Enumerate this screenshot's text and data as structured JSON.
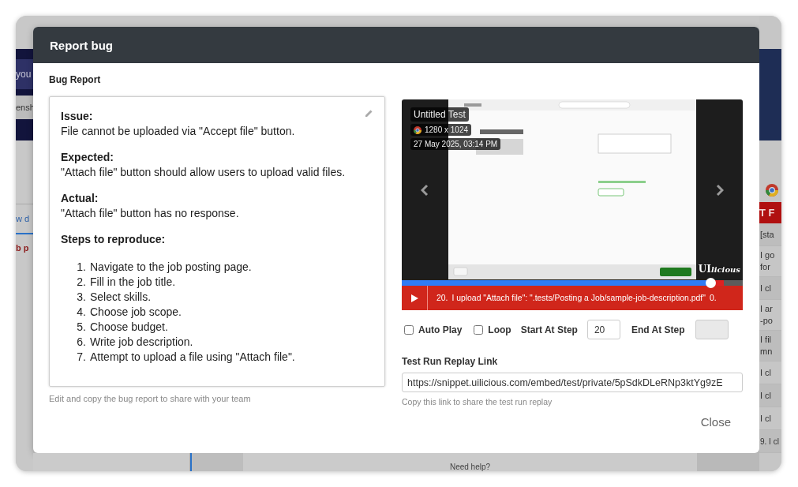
{
  "background_app": {
    "left_texts": [
      {
        "text": "you",
        "kind": "banner"
      },
      {
        "text": "ensh",
        "kind": "strip"
      },
      {
        "text": "w d",
        "kind": "tab"
      },
      {
        "text": "b p",
        "kind": "warning"
      }
    ],
    "right_header": "T F",
    "right_rows": [
      {
        "lines": [
          "[sta"
        ]
      },
      {
        "lines": [
          "I go",
          "for"
        ]
      },
      {
        "lines": [
          "I cl"
        ]
      },
      {
        "lines": [
          "I ar",
          "-po"
        ]
      },
      {
        "lines": [
          "I fil",
          "mn"
        ]
      },
      {
        "lines": [
          "I cl"
        ]
      },
      {
        "lines": [
          "I cl"
        ]
      },
      {
        "lines": [
          "I cl"
        ]
      },
      {
        "lines": [
          "9. I cl"
        ]
      }
    ],
    "bottom_text": "Need help?"
  },
  "dialog": {
    "title": "Report bug",
    "close": "Close"
  },
  "bug_report": {
    "label": "Bug Report",
    "sections": [
      {
        "heading": "Issue:",
        "text": "File cannot be uploaded via \"Accept file\" button."
      },
      {
        "heading": "Expected:",
        "text": "\"Attach file\" button should allow users to upload valid files."
      },
      {
        "heading": "Actual:",
        "text": "\"Attach file\" button has no response."
      }
    ],
    "steps_heading": "Steps to reproduce:",
    "steps": [
      {
        "number": "1.",
        "text": "Navigate to the job posting page."
      },
      {
        "number": "2.",
        "text": "Fill in the job title."
      },
      {
        "number": "3.",
        "text": "Select skills."
      },
      {
        "number": "4.",
        "text": "Choose job scope."
      },
      {
        "number": "5.",
        "text": "Choose budget."
      },
      {
        "number": "6.",
        "text": "Write job description."
      },
      {
        "number": "7.",
        "text": "Attempt to upload a file using \"Attach file\"."
      }
    ],
    "hint": "Edit and copy the bug report to share with your team"
  },
  "replay": {
    "test_name": "Untitled Test",
    "resolution": "1280 x 1024",
    "timestamp": "27 May 2025, 03:14 PM",
    "logo": "UI",
    "logo_script": "licious",
    "progress": {
      "level": 0.905
    },
    "step_number": "20.",
    "step_text": "I upload \"Attach file\": \".tests/Posting a Job/sample-job-description.pdf\"",
    "step_trailing": "0.",
    "auto_play": {
      "label": "Auto Play",
      "checked": false
    },
    "loop": {
      "label": "Loop",
      "checked": false
    },
    "start_step": {
      "label": "Start At Step",
      "value": "20"
    },
    "end_step": {
      "label": "End At Step",
      "disabled": true
    },
    "link_label": "Test Run Replay Link",
    "link_value": "https://snippet.uilicious.com/embed/test/private/5pSdkDLeRNp3ktYg9zE",
    "link_hint": "Copy this link to share the test run replay"
  }
}
